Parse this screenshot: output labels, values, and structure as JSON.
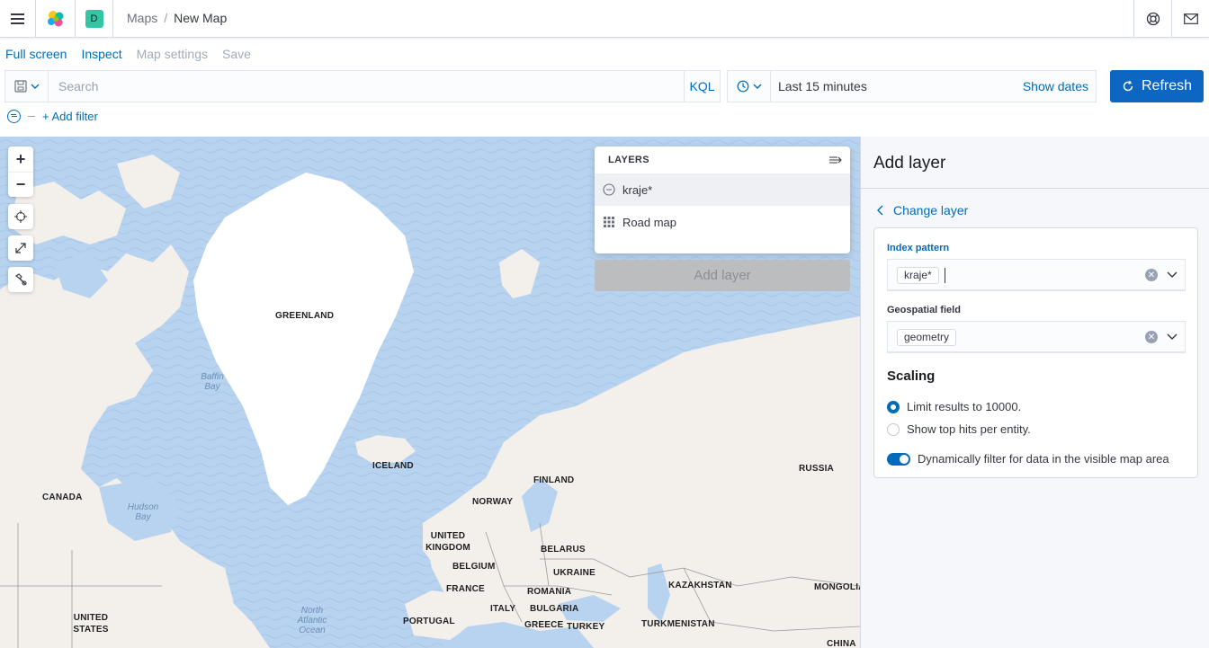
{
  "header": {
    "space_initial": "D",
    "breadcrumbs": [
      "Maps",
      "New Map"
    ],
    "separator": "/"
  },
  "topnav": {
    "full_screen": "Full screen",
    "inspect": "Inspect",
    "map_settings": "Map settings",
    "save": "Save"
  },
  "querybar": {
    "search_placeholder": "Search",
    "language": "KQL",
    "date_range": "Last 15 minutes",
    "show_dates": "Show dates",
    "refresh": "Refresh"
  },
  "filters": {
    "add_filter": "+ Add filter"
  },
  "map": {
    "labels": [
      "GREENLAND",
      "ICELAND",
      "CANADA",
      "NORWAY",
      "FINLAND",
      "RUSSIA",
      "UNITED KINGDOM",
      "BELARUS",
      "BELGIUM",
      "UKRAINE",
      "FRANCE",
      "ROMANIA",
      "KAZAKHSTAN",
      "MONGOLIA",
      "ITALY",
      "BULGARIA",
      "UNITED STATES",
      "PORTUGAL",
      "GREECE",
      "TURKEY",
      "TURKMENISTAN",
      "CHINA"
    ],
    "sea_labels": [
      "Baffin Bay",
      "Hudson Bay",
      "North Atlantic Ocean"
    ]
  },
  "layers_panel": {
    "title": "LAYERS",
    "layers": [
      {
        "name": "kraje*",
        "icon": "minus-circle-icon"
      },
      {
        "name": "Road map",
        "icon": "grid-icon"
      }
    ],
    "add_layer": "Add layer"
  },
  "right_panel": {
    "title": "Add layer",
    "change_layer": "Change layer",
    "index_pattern_label": "Index pattern",
    "index_pattern_value": "kraje*",
    "geospatial_label": "Geospatial field",
    "geospatial_value": "geometry",
    "scaling_title": "Scaling",
    "radio_limit": "Limit results to 10000.",
    "radio_top_hits": "Show top hits per entity.",
    "toggle_label": "Dynamically filter for data in the visible map area"
  },
  "colors": {
    "link": "#006bb8",
    "refresh_bg": "#0d66c2",
    "sea": "#b8d3ef",
    "land": "#f3f0ec"
  }
}
